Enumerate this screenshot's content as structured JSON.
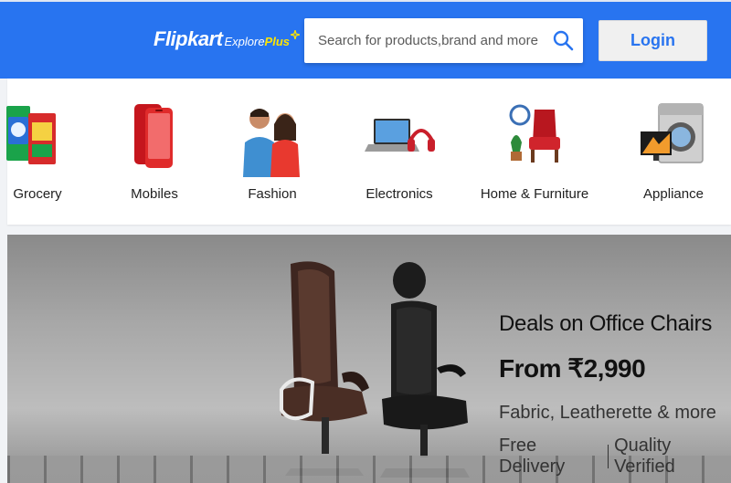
{
  "header": {
    "logo_main": "Flipkart",
    "logo_explore": "Explore",
    "logo_plus": "Plus",
    "search_placeholder": "Search for products,brand and more",
    "search_icon": "search-icon",
    "login_label": "Login",
    "brand_color": "#2874f0",
    "accent_color": "#ffe500"
  },
  "categories": [
    {
      "label": "Grocery",
      "icon": "grocery-icon"
    },
    {
      "label": "Mobiles",
      "icon": "mobile-phone-icon"
    },
    {
      "label": "Fashion",
      "icon": "fashion-models-icon"
    },
    {
      "label": "Electronics",
      "icon": "laptop-headphones-icon"
    },
    {
      "label": "Home & Furniture",
      "icon": "armchair-icon"
    },
    {
      "label": "Appliance",
      "icon": "washing-machine-tv-icon"
    }
  ],
  "banner": {
    "title": "Deals on Office Chairs",
    "price": "From ₹2,990",
    "subtitle": "Fabric, Leatherette & more",
    "tag_left": "Free Delivery",
    "tag_right": "Quality Verified"
  }
}
